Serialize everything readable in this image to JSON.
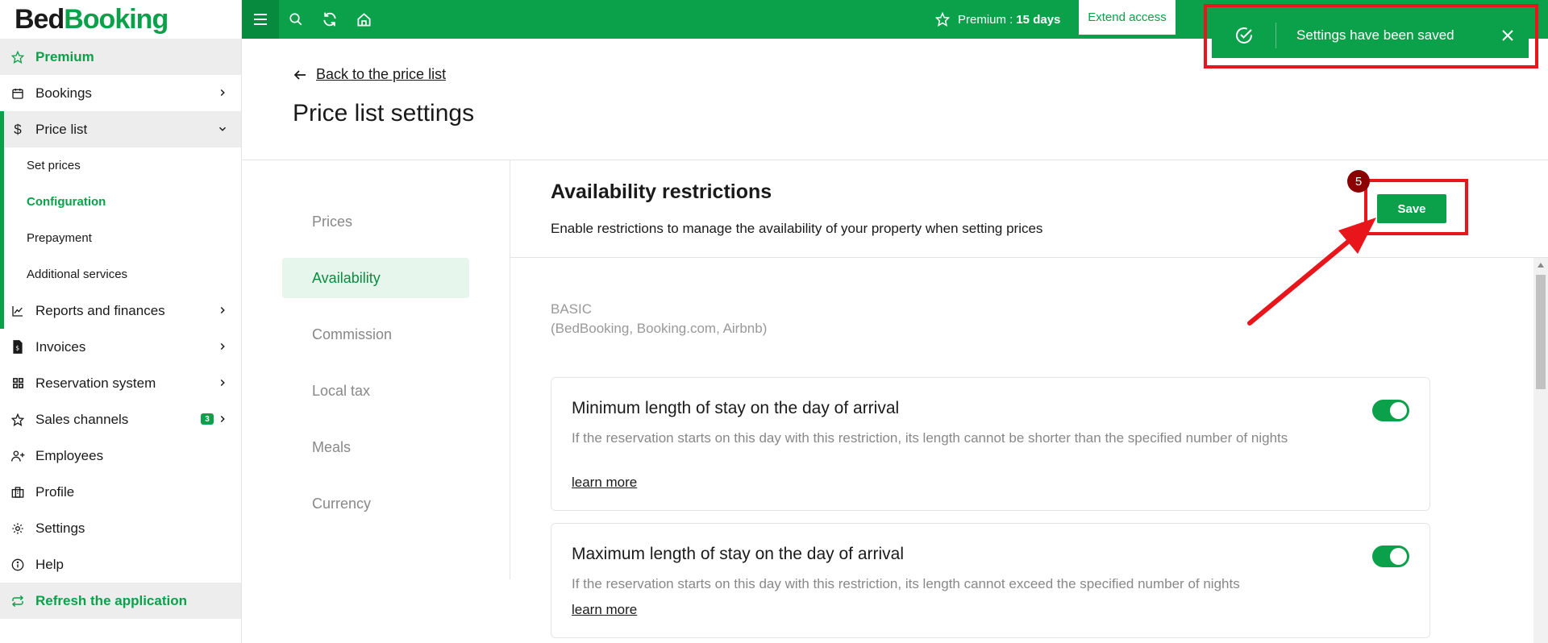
{
  "brand": {
    "part1": "Bed",
    "part2": "Booking",
    "green": "#0aa14a",
    "red": "#e8151b"
  },
  "sidebar": {
    "premium": "Premium",
    "bookings": "Bookings",
    "price_list": "Price list",
    "sub": {
      "set_prices": "Set prices",
      "configuration": "Configuration",
      "prepayment": "Prepayment",
      "additional_services": "Additional services"
    },
    "reports": "Reports and finances",
    "invoices": "Invoices",
    "reservation_system": "Reservation system",
    "sales_channels": "Sales channels",
    "sales_channels_badge": "3",
    "employees": "Employees",
    "profile": "Profile",
    "settings": "Settings",
    "help": "Help",
    "refresh": "Refresh the application"
  },
  "topbar": {
    "icons": [
      "menu-icon",
      "search-icon",
      "refresh-icon",
      "home-icon"
    ],
    "premium_label": "Premium :",
    "premium_days": "15 days",
    "extend": "Extend access"
  },
  "toast": {
    "message": "Settings have been saved"
  },
  "page": {
    "back": "Back to the price list",
    "title": "Price list settings"
  },
  "tabs": [
    "Prices",
    "Availability",
    "Commission",
    "Local tax",
    "Meals",
    "Currency"
  ],
  "active_tab": "Availability",
  "section": {
    "title": "Availability restrictions",
    "description": "Enable restrictions to manage the availability of your property when setting prices",
    "save": "Save",
    "step": "5",
    "group_line1": "BASIC",
    "group_line2": "(BedBooking, Booking.com, Airbnb)"
  },
  "cards": [
    {
      "title": "Minimum length of stay on the day of arrival",
      "desc": "If the reservation starts on this day with this restriction, its length cannot be shorter than the specified number of nights",
      "link": "learn more",
      "enabled": true
    },
    {
      "title": "Maximum length of stay on the day of arrival",
      "desc": "If the reservation starts on this day with this restriction, its length cannot exceed the specified number of nights",
      "link": "learn more",
      "enabled": true
    }
  ]
}
